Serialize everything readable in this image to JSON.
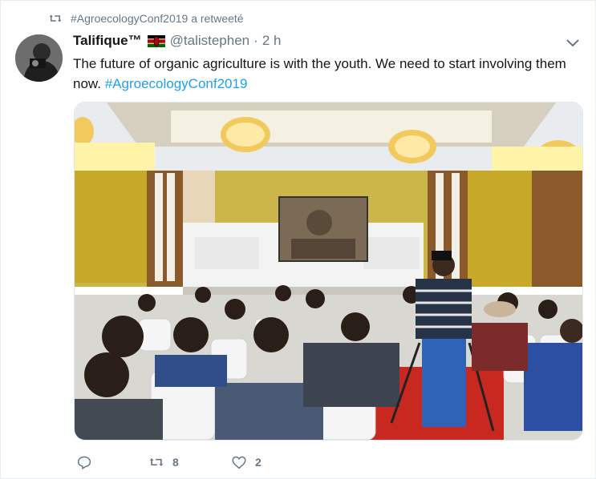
{
  "retweet": {
    "text": "#AgroecologyConf2019 a retweeté",
    "icon": "retweet-icon"
  },
  "tweet": {
    "author_name": "Talifique™",
    "handle": "@talistephen",
    "separator": "·",
    "time": "2 h",
    "text_plain": "The future of organic agriculture is with the youth. We need to start involving them now.",
    "hashtag": "#AgroecologyConf2019",
    "flag_icon": "kenya-flag-icon",
    "image_description_icon": "conference-hall-photo"
  },
  "actions": {
    "reply": {
      "icon": "reply-icon"
    },
    "retweet": {
      "icon": "retweet-icon",
      "count": "8"
    },
    "like": {
      "icon": "heart-icon",
      "count": "2"
    }
  },
  "colors": {
    "link": "#1da1f2",
    "muted": "#657786",
    "text": "#14171a"
  }
}
